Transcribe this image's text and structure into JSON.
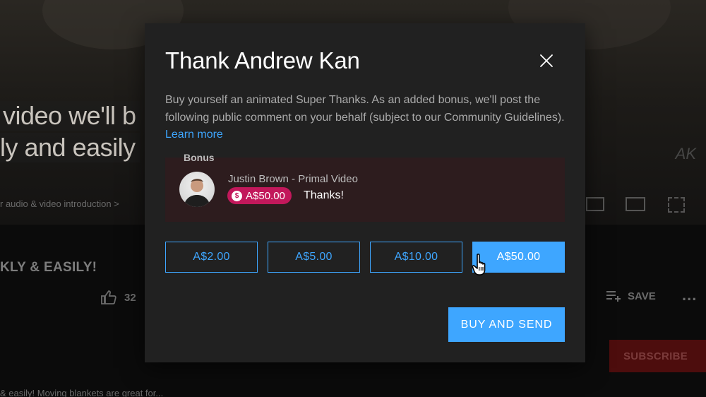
{
  "background": {
    "caption_line1": "video we'll b",
    "caption_line2": "ly and easily",
    "chapter_text": "r audio & video introduction >",
    "video_title": "KLY & EASILY!",
    "like_count": "32",
    "save_label": "SAVE",
    "more_label": "...",
    "subscribe_label": "SUBSCRIBE",
    "description_snippet": "& easily! Moving blankets are great for...",
    "watermark": "AK"
  },
  "modal": {
    "title": "Thank Andrew Kan",
    "description": "Buy yourself an animated Super Thanks. As an added bonus, we'll post the following public comment on your behalf (subject to our Community Guidelines).",
    "learn_more": "Learn more",
    "bonus": {
      "label": "Bonus",
      "commenter_name": "Justin Brown - Primal Video",
      "amount": "A$50.00",
      "comment": "Thanks!"
    },
    "amounts": [
      {
        "label": "A$2.00",
        "selected": false
      },
      {
        "label": "A$5.00",
        "selected": false
      },
      {
        "label": "A$10.00",
        "selected": false
      },
      {
        "label": "A$50.00",
        "selected": true
      }
    ],
    "buy_label": "BUY AND SEND"
  },
  "colors": {
    "accent": "#3ea6ff",
    "modal_bg": "#212121",
    "bonus_bg": "#2d1c1e",
    "chip": "#c2185b"
  },
  "icons": [
    "close-icon",
    "like-icon",
    "save-playlist-icon",
    "super-thanks-icon",
    "hand-cursor-icon"
  ]
}
